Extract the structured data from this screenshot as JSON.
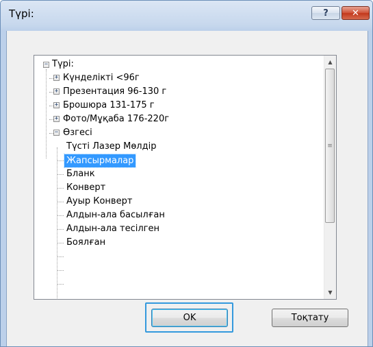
{
  "dialog": {
    "title": "Түрі:",
    "help_label": "?",
    "close_label": "✕"
  },
  "tree": {
    "root_label": "Түрі:",
    "categories": [
      "Күнделікті <96г",
      "Презентация 96-130 г",
      "Брошюра 131-175 г",
      "Фото/Мұқаба 176-220г",
      "Өзгесі"
    ],
    "children": [
      "Түсті Лазер Мөлдір",
      "Жапсырмалар",
      "Бланк",
      "Конверт",
      "Ауыр Конверт",
      "Алдын-ала басылған",
      "Алдын-ала тесілген",
      "Боялған"
    ],
    "selected_item": "Жапсырмалар"
  },
  "scrollbar": {
    "up_arrow": "▲",
    "down_arrow": "▼",
    "thumb_grip": "≡"
  },
  "buttons": {
    "ok_label": "OK",
    "cancel_label": "Тоқтату"
  },
  "colors": {
    "selection": "#3399ff",
    "close_button": "#c2381c",
    "focus_ring": "#3399dd"
  }
}
